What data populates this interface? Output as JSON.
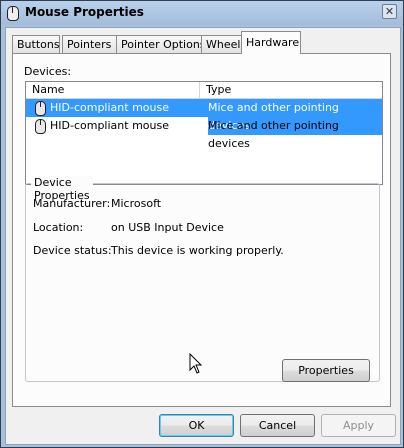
{
  "window": {
    "title": "Mouse Properties",
    "close_glyph": "✕"
  },
  "tabs": [
    {
      "label": "Buttons"
    },
    {
      "label": "Pointers"
    },
    {
      "label": "Pointer Options"
    },
    {
      "label": "Wheel"
    },
    {
      "label": "Hardware"
    }
  ],
  "active_tab": "Hardware",
  "devices": {
    "label": "Devices:",
    "columns": [
      "Name",
      "Type"
    ],
    "rows": [
      {
        "name": "HID-compliant mouse",
        "type": "Mice and other pointing devices",
        "selected": true,
        "icon": "mouse-icon"
      },
      {
        "name": "HID-compliant mouse",
        "type": "Mice and other pointing devices",
        "selected": false,
        "icon": "mouse-icon"
      }
    ]
  },
  "device_properties": {
    "title": "Device Properties",
    "manufacturer_label": "Manufacturer:",
    "manufacturer_value": "Microsoft",
    "location_label": "Location:",
    "location_value": "on USB Input Device",
    "status_label": "Device status:",
    "status_value": "This device is working properly.",
    "properties_button": "Properties"
  },
  "footer": {
    "ok": "OK",
    "cancel": "Cancel",
    "apply": "Apply"
  },
  "colors": {
    "selection": "#3399ff",
    "titlebar": "#b9d1ea"
  }
}
